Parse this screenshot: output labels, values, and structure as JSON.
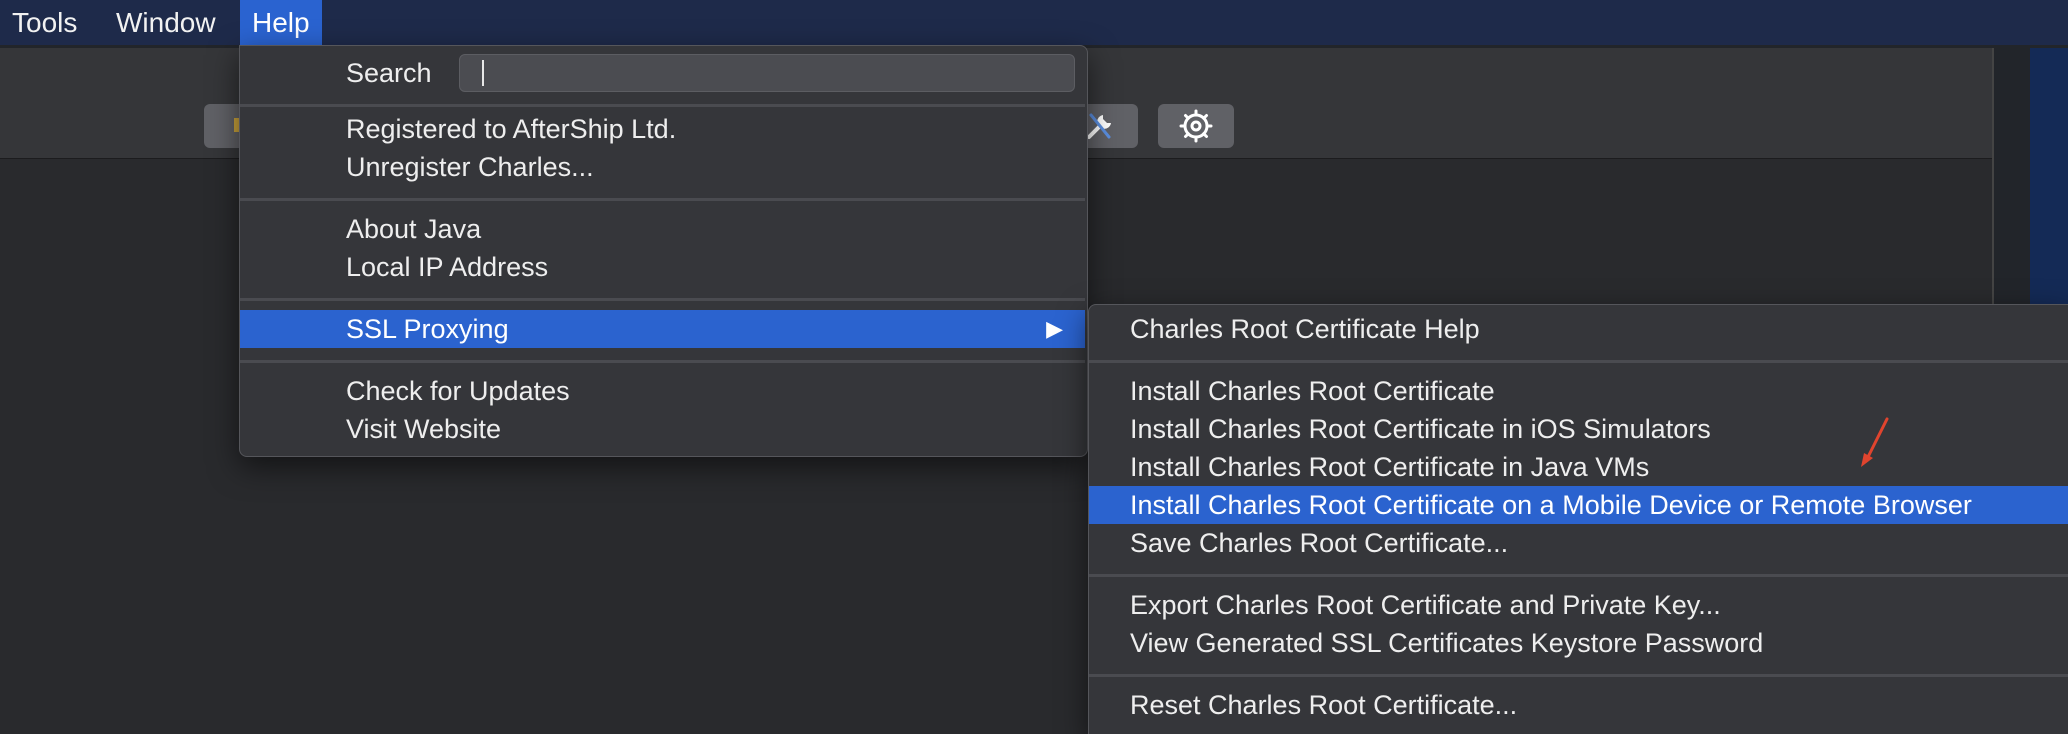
{
  "menubar": {
    "items": [
      {
        "label": "Tools"
      },
      {
        "label": "Window"
      },
      {
        "label": "Help"
      }
    ]
  },
  "help_menu": {
    "search_label": "Search",
    "search_value": "",
    "items": [
      {
        "label": "Registered to AfterShip Ltd."
      },
      {
        "label": "Unregister Charles..."
      },
      {
        "label": "About Java"
      },
      {
        "label": "Local IP Address"
      },
      {
        "label": "SSL Proxying"
      },
      {
        "label": "Check for Updates"
      },
      {
        "label": "Visit Website"
      }
    ]
  },
  "ssl_submenu": {
    "items": [
      {
        "label": "Charles Root Certificate Help"
      },
      {
        "label": "Install Charles Root Certificate"
      },
      {
        "label": "Install Charles Root Certificate in iOS Simulators"
      },
      {
        "label": "Install Charles Root Certificate in Java VMs"
      },
      {
        "label": "Install Charles Root Certificate on a Mobile Device or Remote Browser"
      },
      {
        "label": "Save Charles Root Certificate..."
      },
      {
        "label": "Export Charles Root Certificate and Private Key..."
      },
      {
        "label": "View Generated SSL Certificates Keystore Password"
      },
      {
        "label": "Reset Charles Root Certificate..."
      }
    ]
  },
  "toolbar": {
    "icons": [
      "tools-icon",
      "gear-icon"
    ]
  },
  "colors": {
    "menubar_bg": "#1e2a4a",
    "highlight": "#2b63cf",
    "menu_bg": "#35363a",
    "annotation": "#e0442e"
  }
}
